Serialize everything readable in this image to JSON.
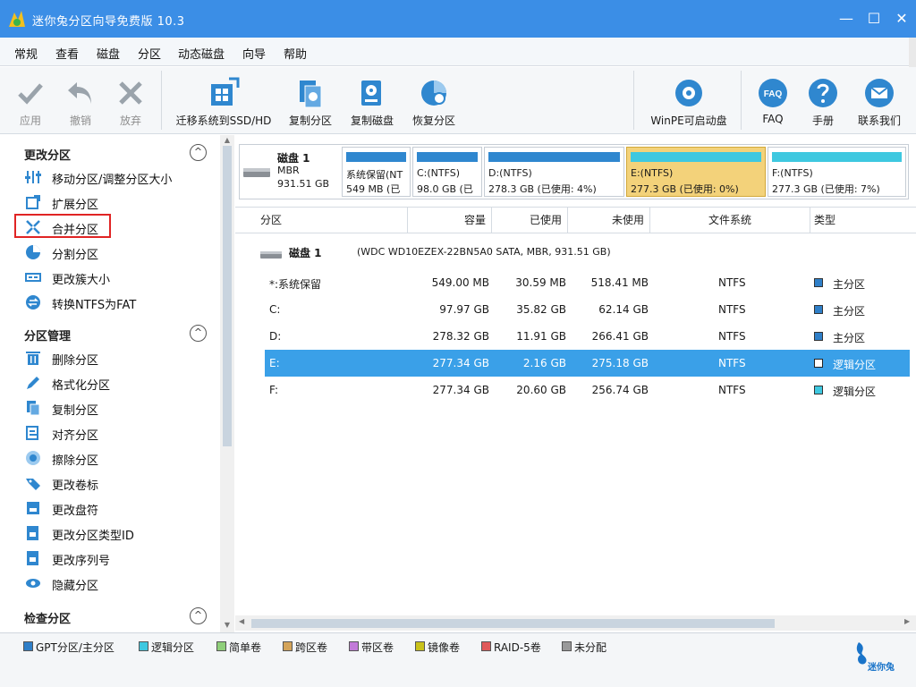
{
  "window": {
    "title": "迷你兔分区向导免费版 10.3",
    "minimize": "—",
    "maximize": "☐",
    "close": "✕"
  },
  "menu": [
    "常规",
    "查看",
    "磁盘",
    "分区",
    "动态磁盘",
    "向导",
    "帮助"
  ],
  "toolbar": {
    "apply": "应用",
    "undo": "撤销",
    "discard": "放弃",
    "migrate": "迁移系统到SSD/HD",
    "copy_partition": "复制分区",
    "copy_disk": "复制磁盘",
    "recover_partition": "恢复分区",
    "winpe": "WinPE可启动盘",
    "faq": "FAQ",
    "manual": "手册",
    "contact": "联系我们",
    "faq_icon_text": "FAQ"
  },
  "sidebar": {
    "sections": [
      {
        "title": "更改分区",
        "items": [
          "移动分区/调整分区大小",
          "扩展分区",
          "合并分区",
          "分割分区",
          "更改簇大小",
          "转换NTFS为FAT"
        ]
      },
      {
        "title": "分区管理",
        "items": [
          "删除分区",
          "格式化分区",
          "复制分区",
          "对齐分区",
          "擦除分区",
          "更改卷标",
          "更改盘符",
          "更改分区类型ID",
          "更改序列号",
          "隐藏分区"
        ]
      },
      {
        "title": "检查分区",
        "items": []
      }
    ],
    "collapse_glyph": "^"
  },
  "diskmap": {
    "disk": {
      "name": "磁盘 1",
      "type": "MBR",
      "size": "931.51 GB"
    },
    "partitions": [
      {
        "line1": "系统保留(NT",
        "line2": "549 MB (已",
        "used_fraction": 1.0
      },
      {
        "line1": "C:(NTFS)",
        "line2": "98.0 GB (已",
        "used_fraction": 1.0
      },
      {
        "line1": "D:(NTFS)",
        "line2": "278.3 GB (已使用: 4%)",
        "used_fraction": 1.0
      },
      {
        "line1": "E:(NTFS)",
        "line2": "277.3 GB (已使用: 0%)",
        "used_fraction": 1.0,
        "selected": true
      },
      {
        "line1": "F:(NTFS)",
        "line2": "277.3 GB (已使用: 7%)",
        "used_fraction": 1.0
      }
    ]
  },
  "table": {
    "columns": [
      "分区",
      "容量",
      "已使用",
      "未使用",
      "文件系统",
      "类型"
    ],
    "disk_row": {
      "name": "磁盘 1",
      "detail": "(WDC WD10EZEX-22BN5A0 SATA, MBR, 931.51 GB)"
    },
    "rows": [
      {
        "partition": "*:系统保留",
        "capacity": "549.00 MB",
        "used": "30.59 MB",
        "unused": "518.41 MB",
        "fs": "NTFS",
        "type": "主分区",
        "swatch": "#2f7fc8"
      },
      {
        "partition": "C:",
        "capacity": "97.97 GB",
        "used": "35.82 GB",
        "unused": "62.14 GB",
        "fs": "NTFS",
        "type": "主分区",
        "swatch": "#2f7fc8"
      },
      {
        "partition": "D:",
        "capacity": "278.32 GB",
        "used": "11.91 GB",
        "unused": "266.41 GB",
        "fs": "NTFS",
        "type": "主分区",
        "swatch": "#2f7fc8"
      },
      {
        "partition": "E:",
        "capacity": "277.34 GB",
        "used": "2.16 GB",
        "unused": "275.18 GB",
        "fs": "NTFS",
        "type": "逻辑分区",
        "swatch": "#3ec8e0",
        "selected": true
      },
      {
        "partition": "F:",
        "capacity": "277.34 GB",
        "used": "20.60 GB",
        "unused": "256.74 GB",
        "fs": "NTFS",
        "type": "逻辑分区",
        "swatch": "#3ec8e0"
      }
    ]
  },
  "legend": [
    {
      "label": "GPT分区/主分区",
      "color": "#2f7fc8"
    },
    {
      "label": "逻辑分区",
      "color": "#3ec8e0"
    },
    {
      "label": "简单卷",
      "color": "#8fcf7a"
    },
    {
      "label": "跨区卷",
      "color": "#d4a45a"
    },
    {
      "label": "带区卷",
      "color": "#c27ad8"
    },
    {
      "label": "镜像卷",
      "color": "#c9c21a"
    },
    {
      "label": "RAID-5卷",
      "color": "#e05a5a"
    },
    {
      "label": "未分配",
      "color": "#9a9a9a"
    }
  ],
  "brand": {
    "text": "迷你兔"
  },
  "colors": {
    "accent": "#3b8ee6",
    "selection": "#3aa0e8",
    "selected_partition": "#f3d27a",
    "highlight_box": "#e02424"
  }
}
